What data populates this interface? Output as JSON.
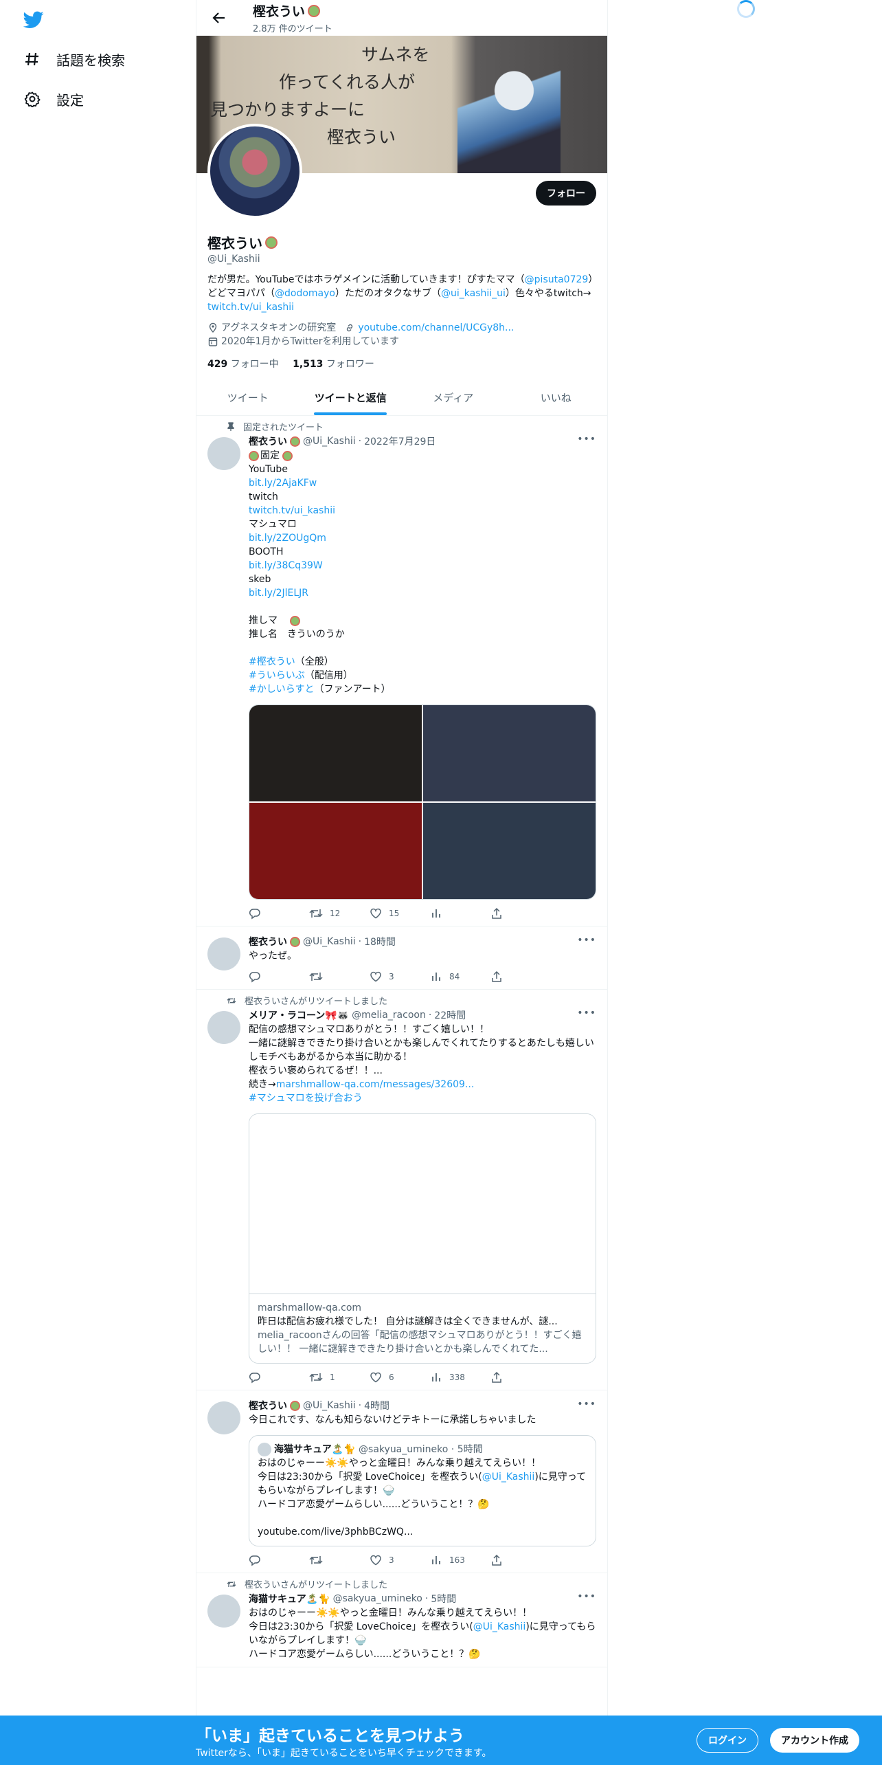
{
  "nav": {
    "logo_icon": "twitter-bird-icon",
    "items": [
      {
        "label": "話題を検索",
        "icon": "hashtag-icon"
      },
      {
        "label": "設定",
        "icon": "gear-icon"
      }
    ]
  },
  "header": {
    "name": "樫衣うい",
    "tweet_count": "2.8万 件のツイート"
  },
  "banner_text": [
    "サムネを",
    "作ってくれる人が",
    "見つかりますよーに",
    "樫衣うい"
  ],
  "profile": {
    "follow_label": "フォロー",
    "name": "樫衣うい",
    "handle": "@Ui_Kashii",
    "bio": {
      "t1": "だが男だ。YouTubeではホラゲメインに活動していきます！ぴすたママ（",
      "m1": "@pisuta0729",
      "t2": "）どどマヨパパ（",
      "m2": "@dodomayo",
      "t3": "）ただのオタクなサブ（",
      "m3": "@ui_kashii_ui",
      "t4": "）色々やるtwitch→ ",
      "link": "twitch.tv/ui_kashii"
    },
    "location": "アグネスタキオンの研究室",
    "website": "youtube.com/channel/UCGy8h...",
    "joined": "2020年1月からTwitterを利用しています",
    "following_count": "429",
    "following_label": "フォロー中",
    "followers_count": "1,513",
    "followers_label": "フォロワー"
  },
  "tabs": [
    "ツイート",
    "ツイートと返信",
    "メディア",
    "いいね"
  ],
  "active_tab": "ツイートと返信",
  "colors": {
    "accent": "#1d9bf0",
    "text": "#0f1419",
    "muted": "#536471",
    "follow_button": "#0f1419"
  },
  "tweets": [
    {
      "pinned_label": "固定されたツイート",
      "name": "樫衣うい",
      "handle": "@Ui_Kashii",
      "time": "2022年7月29日",
      "lines": {
        "fixed": "固定",
        "l1": "YouTube",
        "u1": "bit.ly/2AjaKFw",
        "l2": "twitch",
        "u2": "twitch.tv/ui_kashii",
        "l3": "マシュマロ",
        "u3": "bit.ly/2ZOUgQm",
        "l4": "BOOTH",
        "u4": "bit.ly/38Cq39W",
        "l5": "skeb",
        "u5": "bit.ly/2JlELJR",
        "l6": "推しマ　",
        "l7": "推し名　きういのうか",
        "h1": "#樫衣うい",
        "h1t": "（全般）",
        "h2": "#ういらいぶ",
        "h2t": "（配信用）",
        "h3": "#かしいらすと",
        "h3t": "（ファンアート）"
      },
      "media_colors": [
        "#221f1d",
        "#323a4e",
        "#7c1414",
        "#2d3a4c"
      ],
      "replies": "",
      "retweets": "12",
      "likes": "15",
      "views": ""
    },
    {
      "name": "樫衣うい",
      "handle": "@Ui_Kashii",
      "time": "18時間",
      "text": "やったぜ。",
      "replies": "",
      "retweets": "",
      "likes": "3",
      "views": "84"
    },
    {
      "social": "樫衣ういさんがリツイートしました",
      "name": "メリア・ラコーン🎀🦝",
      "handle": "@melia_racoon",
      "time": "22時間",
      "text": "配信の感想マシュマロありがとう！！すごく嬉しい！！\n一緒に謎解きできたり掛け合いとかも楽しんでくれてたりするとあたしも嬉しいしモチベもあがるから本当に助かる！\n樫衣うい褒められてるぜ！！...",
      "link_prefix": "続き→",
      "link": "marshmallow-qa.com/messages/32609...",
      "hashtag": "#マシュマロを投げ合おう",
      "card": {
        "domain": "marshmallow-qa.com",
        "title": "昨日は配信お疲れ様でした！ 自分は謎解きは全くできませんが、謎...",
        "desc": "melia_racoonさんの回答「配信の感想マシュマロありがとう！！すごく嬉しい！！ 一緒に謎解きできたり掛け合いとかも楽しんでくれてた..."
      },
      "replies": "",
      "retweets": "1",
      "likes": "6",
      "views": "338"
    },
    {
      "name": "樫衣うい",
      "handle": "@Ui_Kashii",
      "time": "4時間",
      "text": "今日これです、なんも知らないけどテキトーに承諾しちゃいました",
      "quote": {
        "name": "海猫サキュア🏝️🐈",
        "handle": "@sakyua_umineko",
        "time": "5時間",
        "l1": "おはのじゃーー☀️☀️やっと金曜日！みんな乗り越えてえらい！！",
        "l2a": "今日は23:30から「択愛 LoveChoice」を樫衣うい(",
        "l2m": "@Ui_Kashii",
        "l2b": ")に見守ってもらいながらプレイします！🍚",
        "l3": "ハードコア恋愛ゲームらしい......どういうこと！？🤔",
        "link": "youtube.com/live/3phbBCzWQ..."
      },
      "replies": "",
      "retweets": "",
      "likes": "3",
      "views": "163"
    },
    {
      "social": "樫衣ういさんがリツイートしました",
      "name": "海猫サキュア🏝️🐈",
      "handle": "@sakyua_umineko",
      "time": "5時間",
      "l1": "おはのじゃーー☀️☀️やっと金曜日！みんな乗り越えてえらい！！",
      "l2a": "今日は23:30から「択愛 LoveChoice」を樫衣うい(",
      "l2m": "@Ui_Kashii",
      "l2b": ")に見守ってもらいながらプレイします！🍚",
      "l3": "ハードコア恋愛ゲームらしい......どういうこと！？🤔"
    }
  ],
  "bottom_bar": {
    "title": "「いま」起きていることを見つけよう",
    "subtitle": "Twitterなら、「いま」起きていることをいち早くチェックできます。",
    "login": "ログイン",
    "signup": "アカウント作成"
  }
}
